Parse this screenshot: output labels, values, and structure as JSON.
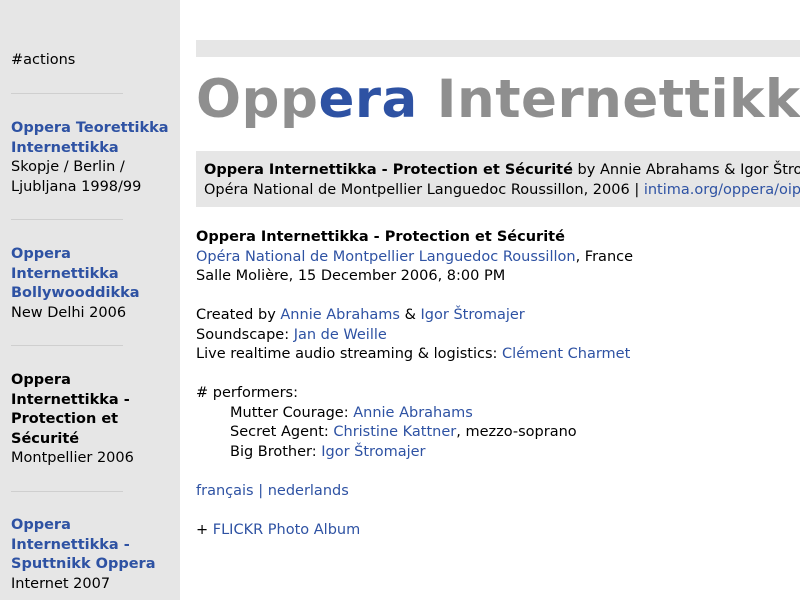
{
  "sidebar": {
    "actions_label": "#actions",
    "entries": [
      {
        "title_lines": [
          "Oppera Teorettikka",
          "Internettikka"
        ],
        "subtitle_lines": [
          "Skopje / Berlin /",
          "Ljubljana 1998/99"
        ]
      },
      {
        "title_lines": [
          "Oppera",
          "Internettikka",
          "Bollywooddikka"
        ],
        "subtitle_lines": [
          "New Delhi 2006"
        ]
      },
      {
        "title_lines": [
          "Oppera",
          "Internettikka -",
          "Protection et",
          "Sécurité"
        ],
        "subtitle_lines": [
          "Montpellier 2006"
        ]
      },
      {
        "title_lines": [
          "Oppera",
          "Internettikka -",
          "Sputtnikk Oppera"
        ],
        "subtitle_lines": [
          "Internet 2007"
        ]
      }
    ]
  },
  "logo": {
    "part1": "Opp",
    "part2": "era",
    "part3": " Internettikka"
  },
  "infobox": {
    "title": "Oppera Internettikka - Protection et Sécurité",
    "by_text": " by Annie Abrahams & Igor Štromajer",
    "line2_text": "Opéra National de Montpellier Languedoc Roussillon, 2006 | ",
    "link": "intima.org/oppera/oips"
  },
  "content": {
    "title": "Oppera Internettikka - Protection et Sécurité",
    "venue_link": "Opéra National de Montpellier Languedoc Roussillon",
    "venue_suffix": ", France",
    "date_line": "Salle Molière, 15 December 2006, 8:00 PM",
    "created_by_label": "Created by ",
    "creator1": "Annie Abrahams",
    "ampersand": " & ",
    "creator2": "Igor Štromajer",
    "soundscape_label": "Soundscape: ",
    "soundscape_person": "Jan de Weille",
    "streaming_label": "Live realtime audio streaming & logistics: ",
    "streaming_person": "Clément Charmet",
    "performers_heading": "# performers:",
    "performers": [
      {
        "role": "Mutter Courage: ",
        "name": "Annie Abrahams",
        "suffix": ""
      },
      {
        "role": "Secret Agent: ",
        "name": "Christine Kattner",
        "suffix": ", mezzo-soprano"
      },
      {
        "role": "Big Brother: ",
        "name": "Igor Štromajer",
        "suffix": ""
      }
    ],
    "lang_fr": "français",
    "lang_sep": " | ",
    "lang_nl": "nederlands",
    "flickr_prefix": "+ ",
    "flickr_link": "FLICKR Photo Album"
  }
}
